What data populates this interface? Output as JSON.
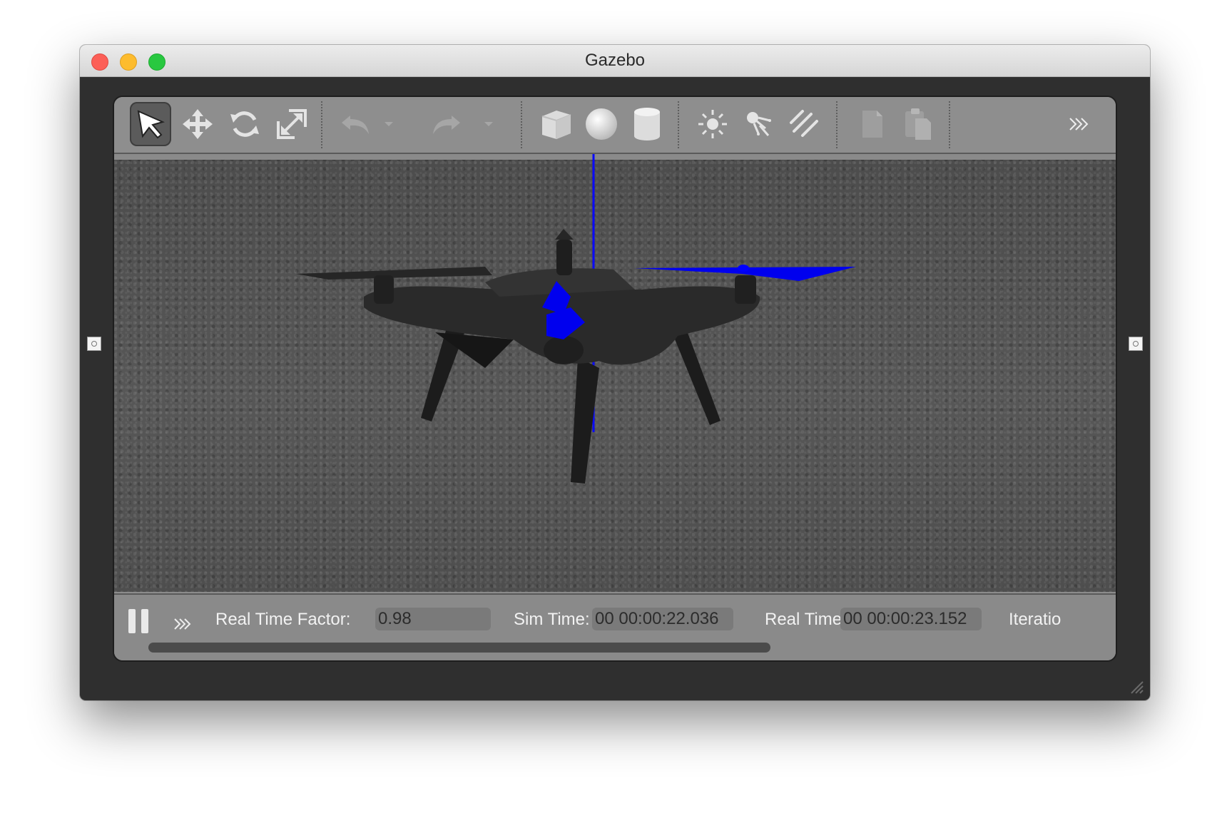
{
  "window": {
    "title": "Gazebo"
  },
  "toolbar": {
    "tools": [
      {
        "name": "select-tool",
        "icon": "arrow-cursor-icon",
        "active": true
      },
      {
        "name": "translate-tool",
        "icon": "move-arrows-icon"
      },
      {
        "name": "rotate-tool",
        "icon": "rotate-icon"
      },
      {
        "name": "scale-tool",
        "icon": "scale-icon"
      },
      {
        "name": "undo-button",
        "icon": "undo-icon"
      },
      {
        "name": "undo-history-dropdown",
        "icon": "caret-down-icon"
      },
      {
        "name": "redo-button",
        "icon": "redo-icon"
      },
      {
        "name": "redo-history-dropdown",
        "icon": "caret-down-icon"
      },
      {
        "name": "box-shape-button",
        "icon": "box-icon"
      },
      {
        "name": "sphere-shape-button",
        "icon": "sphere-icon"
      },
      {
        "name": "cylinder-shape-button",
        "icon": "cylinder-icon"
      },
      {
        "name": "point-light-button",
        "icon": "point-light-icon"
      },
      {
        "name": "spot-light-button",
        "icon": "spot-light-icon"
      },
      {
        "name": "directional-light-button",
        "icon": "directional-light-icon"
      },
      {
        "name": "copy-button",
        "icon": "copy-icon"
      },
      {
        "name": "paste-button",
        "icon": "paste-icon"
      },
      {
        "name": "toolbar-overflow-button",
        "icon": "double-chevron-right-icon"
      }
    ]
  },
  "viewport": {
    "scene": "quadcopter model on asphalt ground plane",
    "highlight_color": "#0000ff"
  },
  "timepanel": {
    "real_time_factor_label": "Real Time Factor:",
    "real_time_factor_value": "0.98",
    "sim_time_label": "Sim Time:",
    "sim_time_value": "00 00:00:22.036",
    "real_time_label": "Real Time:",
    "real_time_value": "00 00:00:23.152",
    "iterations_label": "Iteratio"
  },
  "colors": {
    "window_bg": "#2f2f2f",
    "toolbar_bg": "#8e8e8e",
    "panel_text": "#f2f2f2"
  }
}
